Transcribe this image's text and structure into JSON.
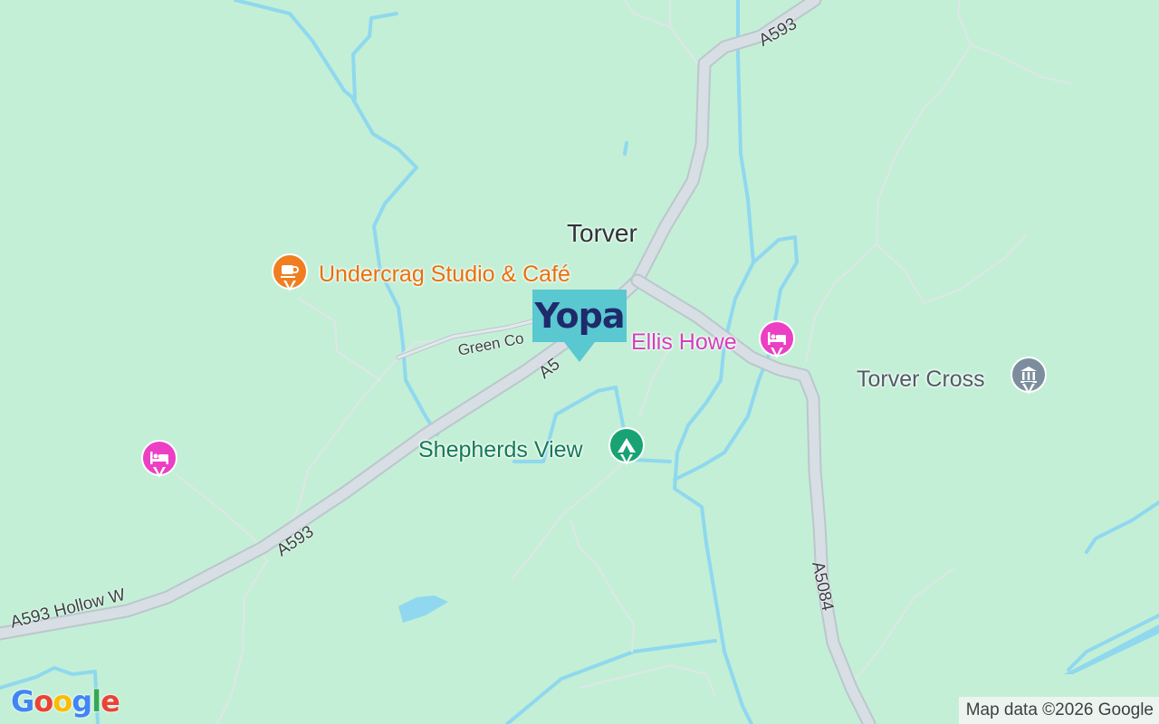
{
  "map": {
    "place_label": "Torver",
    "water_color": "#8fd8ef",
    "land_color": "#c3efd6",
    "road_color": "#d7dee4"
  },
  "roads": [
    {
      "name": "A593"
    },
    {
      "name": "A5"
    },
    {
      "name": "A593"
    },
    {
      "name": "A593 Hollow W"
    },
    {
      "name": "A5084"
    },
    {
      "name": "Green Co"
    }
  ],
  "pois": [
    {
      "name": "Undercrag Studio & Café",
      "category": "cafe",
      "icon": "cup-icon",
      "color": "#f07d1f"
    },
    {
      "name": "Ellis Howe",
      "category": "hotel",
      "icon": "bed-icon",
      "color": "#ec3fc4"
    },
    {
      "name": "Torver Cross",
      "category": "monument",
      "icon": "monument-icon",
      "color": "#7c8e9e"
    },
    {
      "name": "Shepherds View",
      "category": "campground",
      "icon": "tent-icon",
      "color": "#18a374"
    },
    {
      "name": "",
      "category": "hotel",
      "icon": "bed-icon",
      "color": "#ec3fc4"
    }
  ],
  "marker": {
    "text": "Yopa",
    "color": "#5ac8d0",
    "text_color": "#1f2a6b"
  },
  "branding": {
    "logo": [
      "G",
      "o",
      "o",
      "g",
      "l",
      "e"
    ],
    "logo_colors": [
      "#4285f4",
      "#ea4335",
      "#fbbc05",
      "#4285f4",
      "#34a853",
      "#ea4335"
    ]
  },
  "attribution": "Map data ©2026 Google"
}
